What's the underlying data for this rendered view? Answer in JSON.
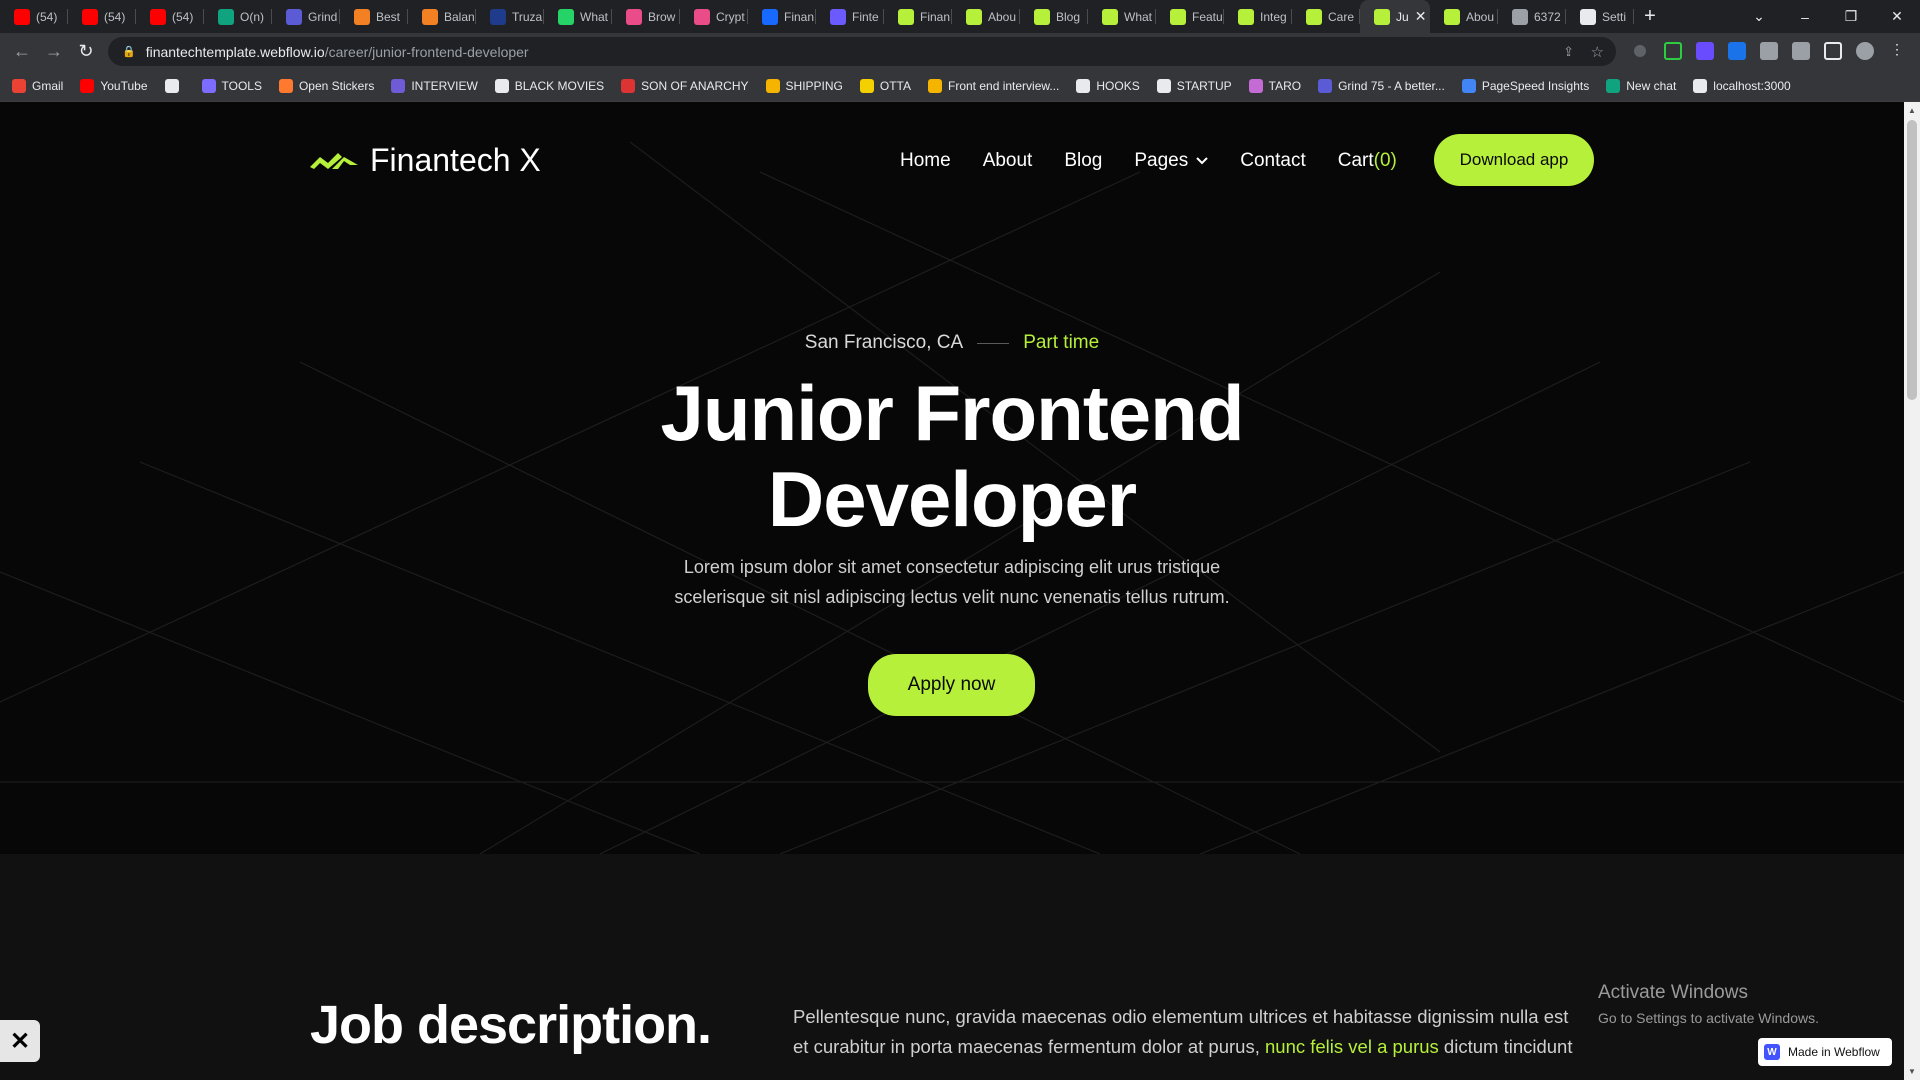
{
  "browser": {
    "tabs": [
      {
        "label": "(54)",
        "icon": "youtube-icon",
        "color": "#ff0000"
      },
      {
        "label": "(54)",
        "icon": "youtube-icon",
        "color": "#ff0000"
      },
      {
        "label": "(54)",
        "icon": "youtube-icon",
        "color": "#ff0000"
      },
      {
        "label": "O(n)",
        "icon": "chatgpt-icon",
        "color": "#10a37f"
      },
      {
        "label": "Grind",
        "icon": "grind-icon",
        "color": "#5b5bd6"
      },
      {
        "label": "Best",
        "icon": "stack-icon",
        "color": "#f48024"
      },
      {
        "label": "Balan",
        "icon": "stack-icon",
        "color": "#f48024"
      },
      {
        "label": "Truza",
        "icon": "truza-icon",
        "color": "#1f3b8c"
      },
      {
        "label": "What",
        "icon": "whatsapp-icon",
        "color": "#25d366"
      },
      {
        "label": "Brow",
        "icon": "dribbble-icon",
        "color": "#ea4c89"
      },
      {
        "label": "Crypt",
        "icon": "dribbble-icon",
        "color": "#ea4c89"
      },
      {
        "label": "Finan",
        "icon": "behance-icon",
        "color": "#1769ff"
      },
      {
        "label": "Finte",
        "icon": "dots-icon",
        "color": "#6b5bff"
      },
      {
        "label": "Finan",
        "icon": "finantech-icon",
        "color": "#b6f03a"
      },
      {
        "label": "Abou",
        "icon": "finantech-icon",
        "color": "#b6f03a"
      },
      {
        "label": "Blog",
        "icon": "finantech-icon",
        "color": "#b6f03a"
      },
      {
        "label": "What",
        "icon": "finantech-icon",
        "color": "#b6f03a"
      },
      {
        "label": "Featu",
        "icon": "finantech-icon",
        "color": "#b6f03a"
      },
      {
        "label": "Integ",
        "icon": "finantech-icon",
        "color": "#b6f03a"
      },
      {
        "label": "Care",
        "icon": "finantech-icon",
        "color": "#b6f03a"
      },
      {
        "label": "Ju",
        "icon": "finantech-icon",
        "color": "#b6f03a",
        "active": true
      },
      {
        "label": "Abou",
        "icon": "finantech-icon",
        "color": "#b6f03a"
      },
      {
        "label": "6372",
        "icon": "globe-icon",
        "color": "#9aa0a6"
      },
      {
        "label": "Setti",
        "icon": "gear-icon",
        "color": "#e8eaed"
      }
    ],
    "url_host": "finantechtemplate.webflow.io",
    "url_path": "/career/junior-frontend-developer",
    "bookmarks": [
      {
        "label": "Gmail",
        "color": "#ea4335"
      },
      {
        "label": "YouTube",
        "color": "#ff0000"
      },
      {
        "label": "",
        "color": "#e8eaed"
      },
      {
        "label": "TOOLS",
        "color": "#7c6cff"
      },
      {
        "label": "Open Stickers",
        "color": "#ff7a2f"
      },
      {
        "label": "INTERVIEW",
        "color": "#6f5bd6"
      },
      {
        "label": "BLACK MOVIES",
        "color": "#e8eaed"
      },
      {
        "label": "SON OF ANARCHY",
        "color": "#d33"
      },
      {
        "label": "SHIPPING",
        "color": "#f4b400"
      },
      {
        "label": "OTTA",
        "color": "#f4d000"
      },
      {
        "label": "Front end interview...",
        "color": "#f4b400"
      },
      {
        "label": "HOOKS",
        "color": "#e8eaed"
      },
      {
        "label": "STARTUP",
        "color": "#e8eaed"
      },
      {
        "label": "TARO",
        "color": "#c56bd6"
      },
      {
        "label": "Grind 75 - A better...",
        "color": "#5b5bd6"
      },
      {
        "label": "PageSpeed Insights",
        "color": "#4285f4"
      },
      {
        "label": "New chat",
        "color": "#10a37f"
      },
      {
        "label": "localhost:3000",
        "color": "#e8eaed"
      }
    ]
  },
  "site": {
    "brand": "Finantech X",
    "nav": {
      "home": "Home",
      "about": "About",
      "blog": "Blog",
      "pages": "Pages",
      "contact": "Contact",
      "cart": "Cart",
      "cart_count": "(0)",
      "download": "Download app"
    },
    "hero": {
      "location": "San Francisco, CA",
      "job_type": "Part time",
      "title_line1": "Junior Frontend",
      "title_line2": "Developer",
      "description": "Lorem ipsum dolor sit amet consectetur adipiscing elit urus tristique scelerisque sit nisl adipiscing lectus velit nunc venenatis tellus rutrum.",
      "apply": "Apply now"
    },
    "job": {
      "heading": "Job description.",
      "text_before": "Pellentesque nunc, gravida maecenas odio elementum ultrices et habitasse dignissim nulla est et curabitur in porta maecenas fermentum dolor at purus, ",
      "text_link": "nunc felis vel a purus",
      "text_after": " dictum tincidunt"
    },
    "accent": "#b6f03a"
  },
  "overlay": {
    "activate_title": "Activate Windows",
    "activate_sub": "Go to Settings to activate Windows.",
    "webflow_badge": "Made in Webflow"
  }
}
